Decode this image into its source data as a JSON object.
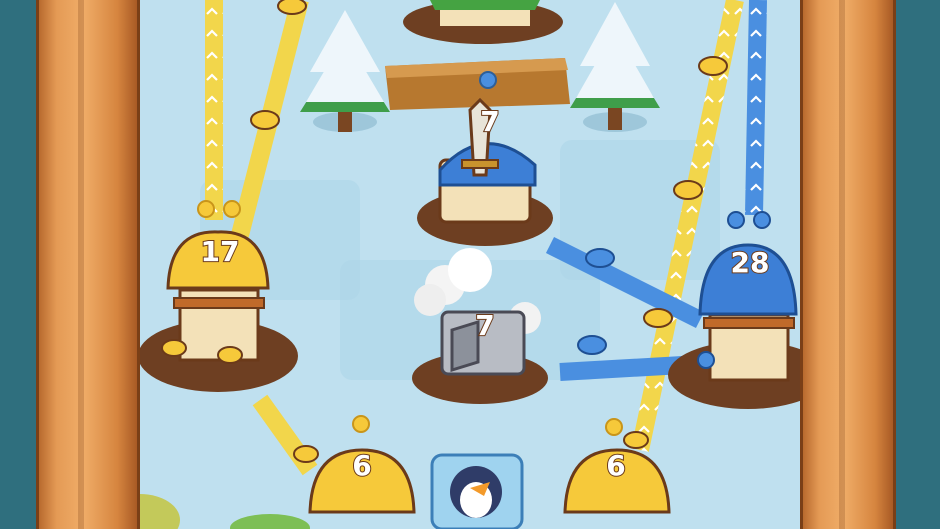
{
  "buildings": {
    "yellow_tower_left": {
      "count": "17",
      "team": "yellow"
    },
    "blue_tower_right": {
      "count": "28",
      "team": "blue"
    },
    "blue_barracks_center": {
      "count": "7",
      "team": "blue"
    },
    "neutral_forge_center": {
      "count": "7",
      "team": "neutral"
    },
    "yellow_hut_bottom_left": {
      "count": "6",
      "team": "yellow"
    },
    "yellow_hut_bottom_right": {
      "count": "6",
      "team": "yellow"
    }
  },
  "colors": {
    "yellow_team": "#f6c93a",
    "blue_team": "#4a8fe0",
    "ice": "#bfe0ef",
    "dirt": "#6e3f22",
    "wood": "#e49a55"
  }
}
